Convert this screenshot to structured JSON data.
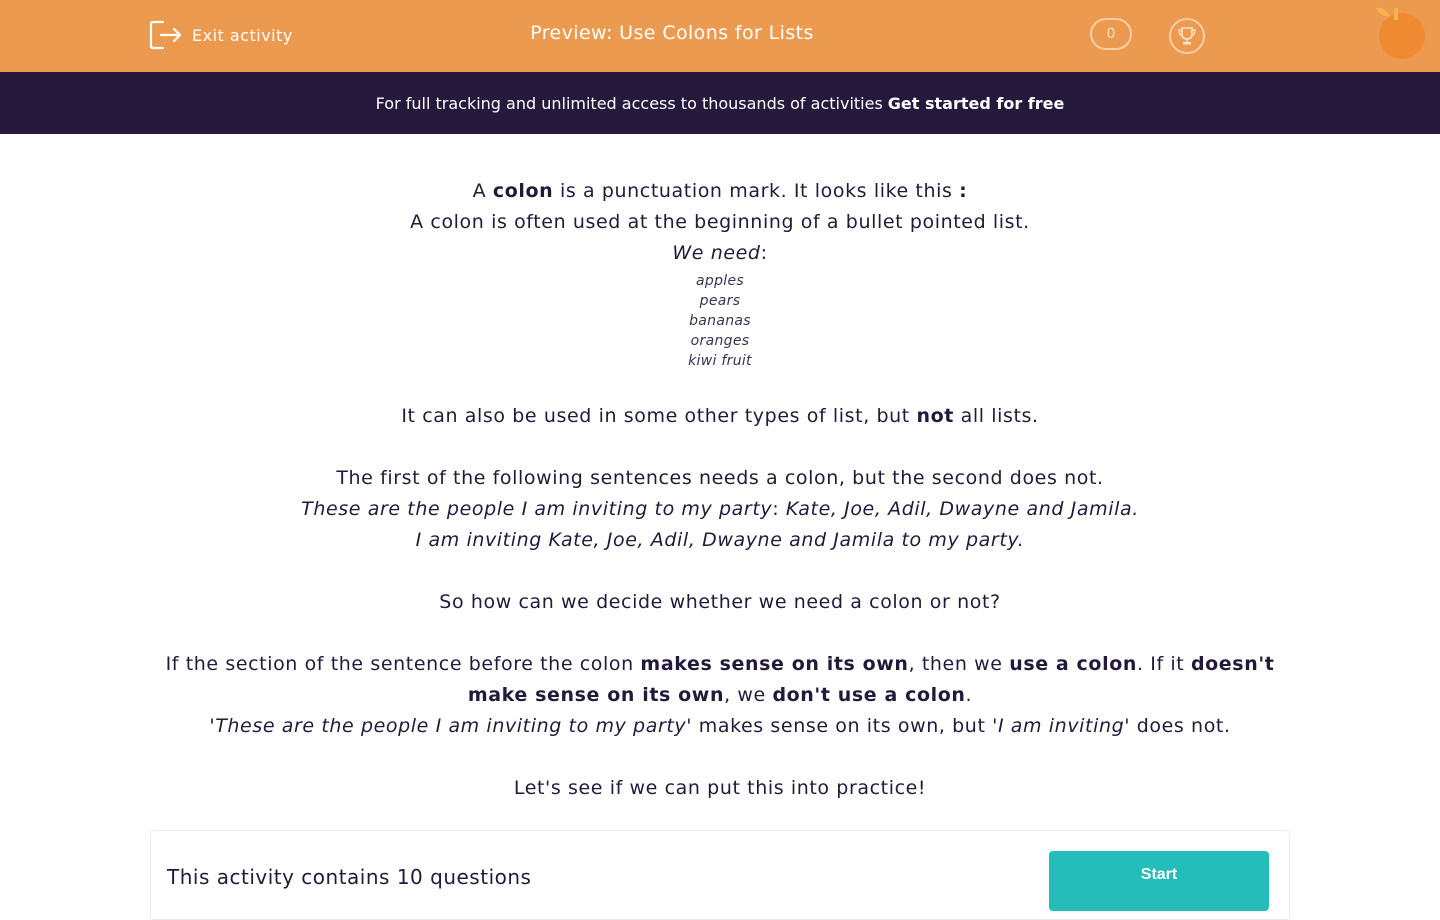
{
  "header": {
    "exit_label": "Exit activity",
    "title": "Preview: Use Colons for Lists",
    "score": "0",
    "bg_color": "#eb9a50"
  },
  "banner": {
    "text": "For full tracking and unlimited access to thousands of activities",
    "link": "Get started for free",
    "bg_color": "#251a3c"
  },
  "content": {
    "l1": {
      "a": "A ",
      "b": "colon",
      "c": " is a punctuation mark. It looks like this ",
      "d": ":"
    },
    "l2": "A colon is often used at the beginning of a bullet pointed list.",
    "l3": {
      "a": "We need",
      "b": ":"
    },
    "list": [
      "apples",
      "pears",
      "bananas",
      "oranges",
      "kiwi fruit"
    ],
    "l4": {
      "a": "It can also be used in some other types of list, but ",
      "b": "not",
      "c": " all lists."
    },
    "l5": "The first of the following sentences needs a colon, but the second does not.",
    "l6": {
      "a": "These are the people I am inviting to my party",
      "b": ": ",
      "c": "Kate, Joe, Adil, Dwayne and Jamila."
    },
    "l7": "I am inviting Kate, Joe, Adil, Dwayne and Jamila to my party.",
    "l8": "So how can we decide whether we need a colon or not?",
    "l9": {
      "a": "If the section of the sentence before the colon ",
      "b": "makes sense on its own",
      "c": ", then we ",
      "d": "use a colon",
      "e": ". If it ",
      "f": "doesn't make sense on its own",
      "g": ", we ",
      "h": "don't use a colon",
      "i": "."
    },
    "l10": {
      "a": "'",
      "b": "These are the people I am inviting to my party",
      "c": "' makes sense on its own, but '",
      "d": "I am inviting",
      "e": "' does not."
    },
    "l11": "Let's see if we can put this into practice!"
  },
  "card": {
    "text": "This activity contains 10 questions",
    "start_label": "Start",
    "button_color": "#24bdb9"
  },
  "icons": [
    "exit-icon",
    "trophy-icon",
    "orange-logo-icon"
  ]
}
